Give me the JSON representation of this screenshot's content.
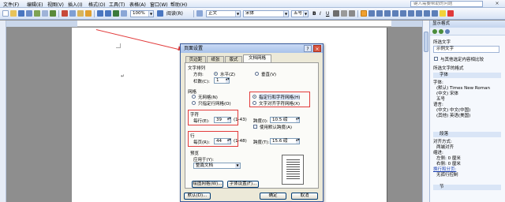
{
  "menubar": {
    "items": [
      "文件(F)",
      "编辑(E)",
      "视图(V)",
      "插入(I)",
      "格式(O)",
      "工具(T)",
      "表格(A)",
      "窗口(W)",
      "帮助(H)"
    ],
    "help_placeholder": "键入需要帮助的问题",
    "close_glyph": "×"
  },
  "toolbar": {
    "zoom": "100%",
    "read_label": "阅读(R)",
    "style": "正文",
    "font": "宋体",
    "size": "五号",
    "bold": "B",
    "italic": "I",
    "underline": "U"
  },
  "document": {
    "para_mark": "↵"
  },
  "dialog": {
    "title": "页面设置",
    "help_glyph": "?",
    "close_glyph": "×",
    "tabs": [
      "页边距",
      "纸张",
      "版式",
      "文档网格"
    ],
    "text_direction_label": "文字排列",
    "direction_label": "方向:",
    "horizontal": "水平(Z)",
    "vertical": "垂直(V)",
    "columns_label": "栏数(C):",
    "columns_value": "1",
    "grid_label": "网格",
    "no_grid": "无网格(N)",
    "line_grid": "只指定行网格(O)",
    "char_line_grid": "指定行和字符网格(H)",
    "snap_chars": "文字对齐字符网格(X)",
    "chars_section": "字符",
    "per_line_label": "每行(E):",
    "per_line_value": "39",
    "per_line_range": "(1-43)",
    "pitch_label": "跨度(I):",
    "pitch_value": "10.5 磅",
    "default_pitch": "使用默认跨度(A)",
    "lines_section": "行",
    "per_page_label": "每页(R):",
    "per_page_value": "44",
    "per_page_range": "(1-48)",
    "line_pitch_label": "跨度(T):",
    "line_pitch_value": "15.6 磅",
    "preview_label": "预览",
    "apply_to_label": "应用于(Y):",
    "apply_to_value": "整篇文档",
    "draw_grid_btn": "绘图网格(W)...",
    "font_settings_btn": "字体设置(F)...",
    "default_btn": "默认(D)...",
    "ok_btn": "确定",
    "cancel_btn": "取消"
  },
  "taskpane": {
    "title": "显示格式",
    "selected_text_label": "所选文字",
    "sample_text": "示例文字",
    "compare_label": "与其他选定内容相比较",
    "format_of_label": "所选文字的格式",
    "font_section": "字体",
    "font_lines": [
      "字体:",
      "(默认) Times New Roman",
      "(中文) 宋体",
      "五号",
      "语言:",
      "(中文) 中文(中国)",
      "(其他) 英语(美国)"
    ],
    "para_section": "段落",
    "para_lines": [
      "对齐方式:",
      "两端对齐",
      "缩进:",
      "左侧: 0 厘米",
      "右侧: 0 厘米",
      "换行和分页:",
      "无孤行控制"
    ],
    "section_section": "节"
  },
  "colors": {
    "annotation_red": "#e23b3b",
    "title_blue": "#a8c2ea"
  }
}
